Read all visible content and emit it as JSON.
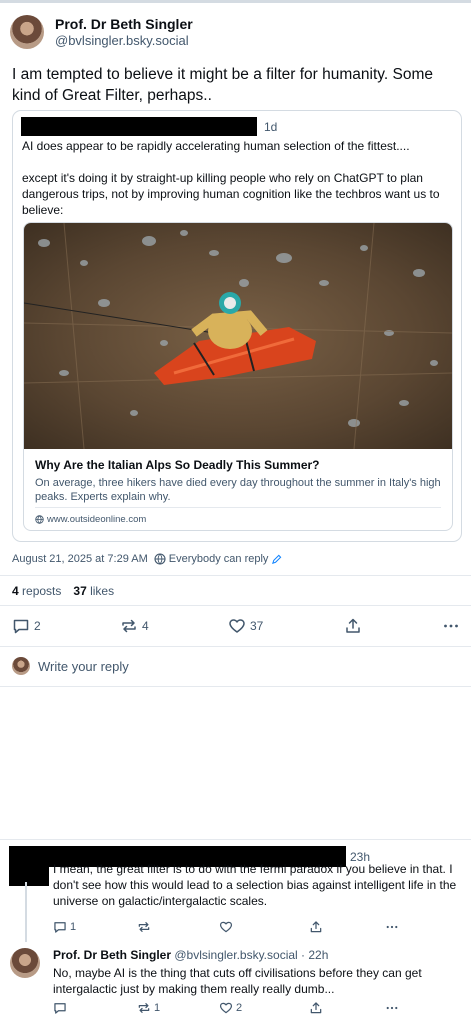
{
  "post": {
    "author_name": "Prof. Dr Beth Singler",
    "author_handle": "@bvlsingler.bsky.social",
    "text": "I am tempted to believe it might be a filter for humanity. Some kind of Great Filter, perhaps.."
  },
  "quote": {
    "time": "1d",
    "text_1": "AI does appear to be rapidly accelerating human selection of the fittest....",
    "text_2": "except it's doing it by straight-up killing people who rely on ChatGPT to plan dangerous trips, not by improving human cognition like the techbros want us to believe:",
    "card": {
      "title": "Why Are the Italian Alps So Deadly This Summer?",
      "description": "On average, three hikers have died every day throughout the summer in Italy's high peaks. Experts explain why.",
      "url": "www.outsideonline.com"
    }
  },
  "meta": {
    "timestamp": "August 21, 2025 at 7:29 AM",
    "reply_setting": "Everybody can reply"
  },
  "stats": {
    "reposts_count": "4",
    "reposts_label": "reposts",
    "likes_count": "37",
    "likes_label": "likes"
  },
  "actions": {
    "replies": "2",
    "reposts": "4",
    "likes": "37"
  },
  "reply_prompt": "Write your reply",
  "comments": [
    {
      "time": "23h",
      "text": "I mean, the great filter is to do with the fermi paradox if you believe in that. I don't see how this would lead to a selection bias against intelligent life in the universe on galactic/intergalactic scales.",
      "replies": "1"
    },
    {
      "author_name": "Prof. Dr Beth Singler",
      "author_handle": "@bvlsingler.bsky.social · 22h",
      "text": "No, maybe AI is the thing that cuts off civilisations before they can get intergalactic just by making them really really dumb...",
      "reposts": "1",
      "likes": "2"
    }
  ],
  "icons": [
    "reply-icon",
    "repost-icon",
    "like-icon",
    "share-icon",
    "more-icon",
    "globe-icon",
    "edit-icon",
    "link-icon"
  ],
  "colors": {
    "text": "#0b0f14",
    "muted": "#42576c",
    "accent": "#1083fe",
    "border": "#d4dbe2"
  }
}
